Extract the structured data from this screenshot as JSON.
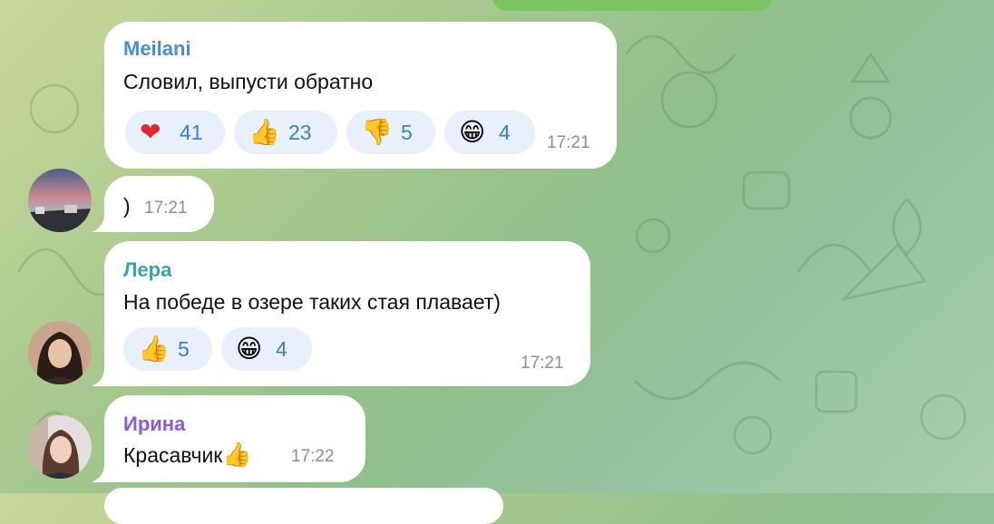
{
  "messages": [
    {
      "sender": "Meilani",
      "sender_color": "#4a8bd1",
      "text": "Словил, выпусти обратно",
      "time": "17:21",
      "reactions": [
        {
          "icon": "heart-icon",
          "emoji": "❤",
          "count": "41"
        },
        {
          "icon": "thumbs-up-icon",
          "emoji": "👍",
          "count": "23"
        },
        {
          "icon": "thumbs-down-icon",
          "emoji": "👎",
          "count": "5"
        },
        {
          "icon": "grinning-face-icon",
          "emoji": "😁",
          "count": "4"
        }
      ]
    },
    {
      "sender": "",
      "text": ")",
      "time": "17:21",
      "reactions": []
    },
    {
      "sender": "Лера",
      "sender_color": "#3a9fb8",
      "text": "На победе в озере таких стая плавает)",
      "time": "17:21",
      "reactions": [
        {
          "icon": "thumbs-up-icon",
          "emoji": "👍",
          "count": "5"
        },
        {
          "icon": "grinning-face-icon",
          "emoji": "😁",
          "count": "4"
        }
      ]
    },
    {
      "sender": "Ирина",
      "sender_color": "#8a5bd6",
      "text": "Красавчик",
      "emoji_suffix": "👍",
      "time": "17:22",
      "reactions": []
    }
  ],
  "colors": {
    "reaction_bg": "#e8f0fb",
    "reaction_count": "#3b7ed6",
    "outgoing_bubble": "#7cc460"
  }
}
